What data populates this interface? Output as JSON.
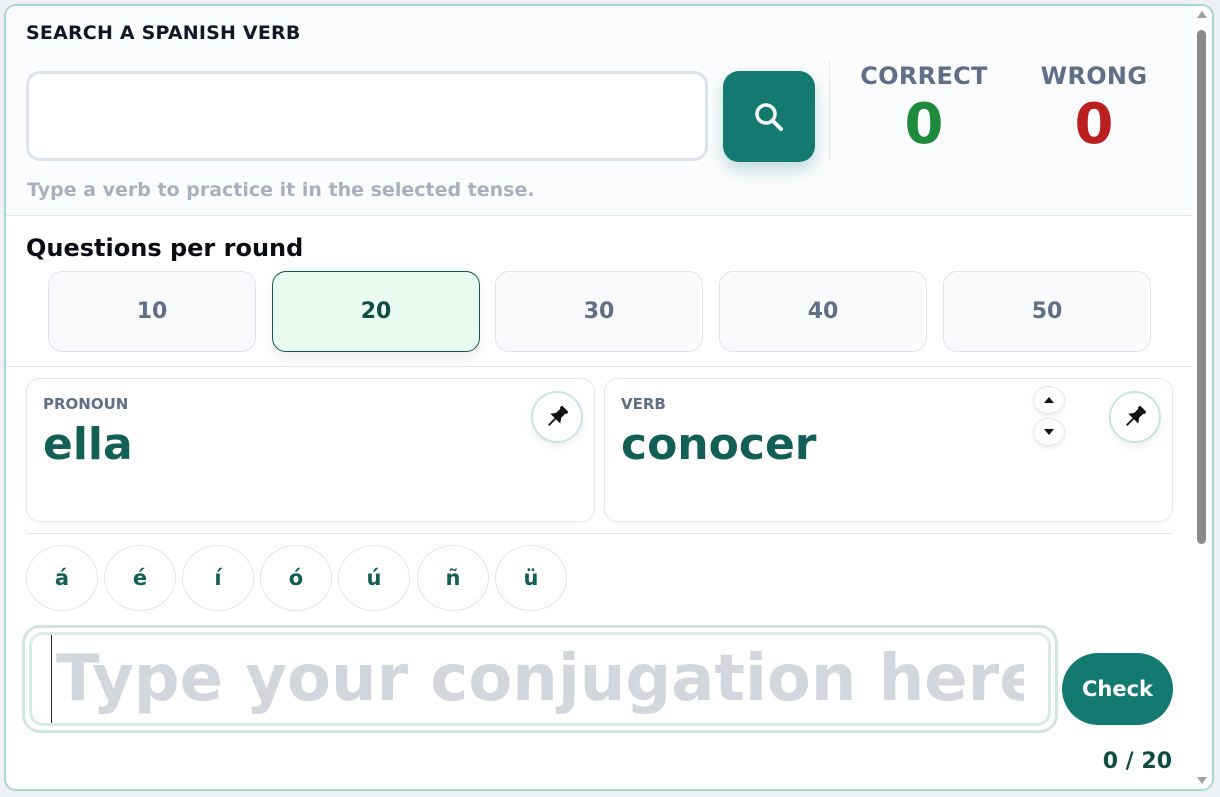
{
  "search": {
    "heading": "SEARCH A SPANISH VERB",
    "value": "",
    "placeholder": "",
    "hint": "Type a verb to practice it in the selected tense.",
    "button_icon": "search-icon"
  },
  "score": {
    "correct_label": "CORRECT",
    "correct_value": "0",
    "wrong_label": "WRONG",
    "wrong_value": "0",
    "correct_color": "#1e8a3b",
    "wrong_color": "#bb2020"
  },
  "rounds": {
    "title": "Questions per round",
    "options": [
      "10",
      "20",
      "30",
      "40",
      "50"
    ],
    "selected": "20"
  },
  "pronoun": {
    "label": "PRONOUN",
    "value": "ella",
    "pin_icon": "pin-icon"
  },
  "verb": {
    "label": "VERB",
    "value": "conocer",
    "pin_icon": "pin-icon",
    "up_icon": "caret-up-icon",
    "down_icon": "caret-down-icon"
  },
  "accents": [
    "á",
    "é",
    "í",
    "ó",
    "ú",
    "ñ",
    "ü"
  ],
  "answer": {
    "value": "",
    "placeholder": "Type your conjugation here.",
    "check_label": "Check"
  },
  "progress": {
    "text": "0 / 20"
  },
  "colors": {
    "accent": "#147a6f",
    "text_primary": "#135f56"
  }
}
